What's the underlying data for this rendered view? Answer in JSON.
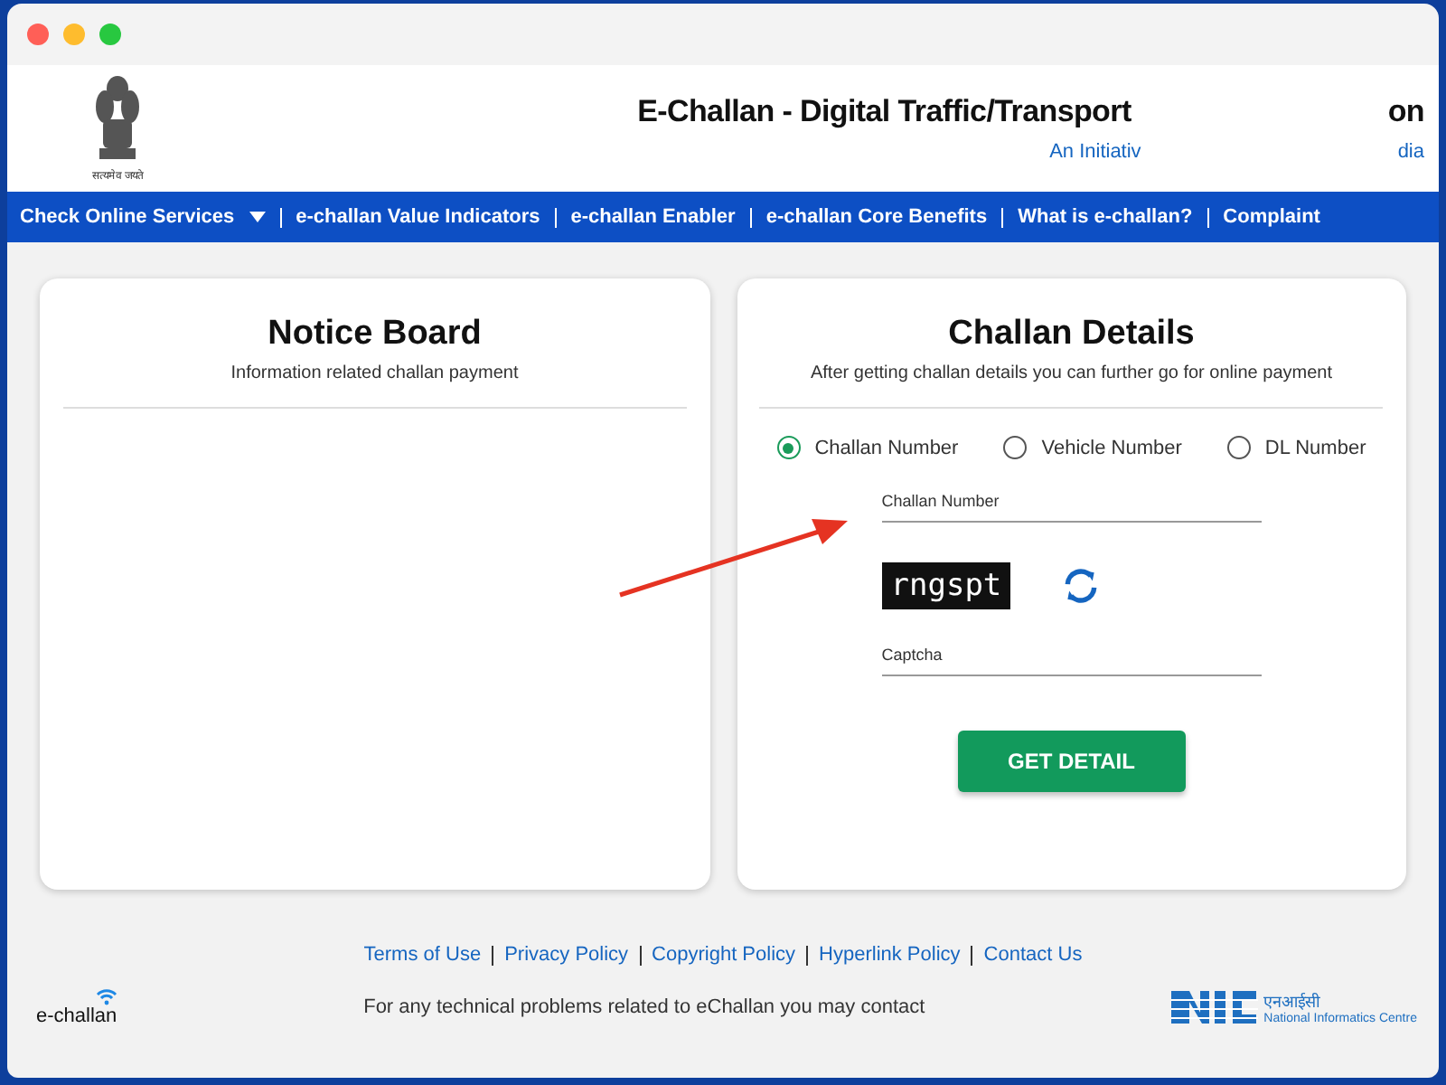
{
  "header": {
    "emblem_motto": "सत्यमेव जयते",
    "title_visible": "E-Challan - Digital Traffic/Transport",
    "title_tail": "on",
    "subtitle_visible": "An Initiativ",
    "subtitle_tail": "dia"
  },
  "nav": [
    {
      "label": "Check Online Services",
      "dropdown": true
    },
    {
      "label": "e-challan Value Indicators",
      "dropdown": false
    },
    {
      "label": "e-challan Enabler",
      "dropdown": false
    },
    {
      "label": "e-challan Core Benefits",
      "dropdown": false
    },
    {
      "label": "What is e-challan?",
      "dropdown": false
    },
    {
      "label": "Complaint",
      "dropdown": false
    }
  ],
  "notice_board": {
    "title": "Notice Board",
    "subtitle": "Information related challan payment"
  },
  "challan_details": {
    "title": "Challan Details",
    "subtitle": "After getting challan details you can further go for online payment",
    "options": [
      {
        "label": "Challan Number",
        "selected": true
      },
      {
        "label": "Vehicle Number",
        "selected": false
      },
      {
        "label": "DL Number",
        "selected": false
      }
    ],
    "number_field": {
      "placeholder": "Challan Number"
    },
    "captcha_text": "rngspt",
    "captcha_field": {
      "placeholder": "Captcha"
    },
    "button": "GET DETAIL"
  },
  "footer": {
    "links": [
      "Terms of Use",
      "Privacy Policy",
      "Copyright Policy",
      "Hyperlink Policy",
      "Contact Us"
    ],
    "contact": "For any technical problems related to eChallan you may contact",
    "left_logo": "e-challan",
    "right_logo_hindi": "एनआईसी",
    "right_logo_name": "National Informatics Centre"
  }
}
